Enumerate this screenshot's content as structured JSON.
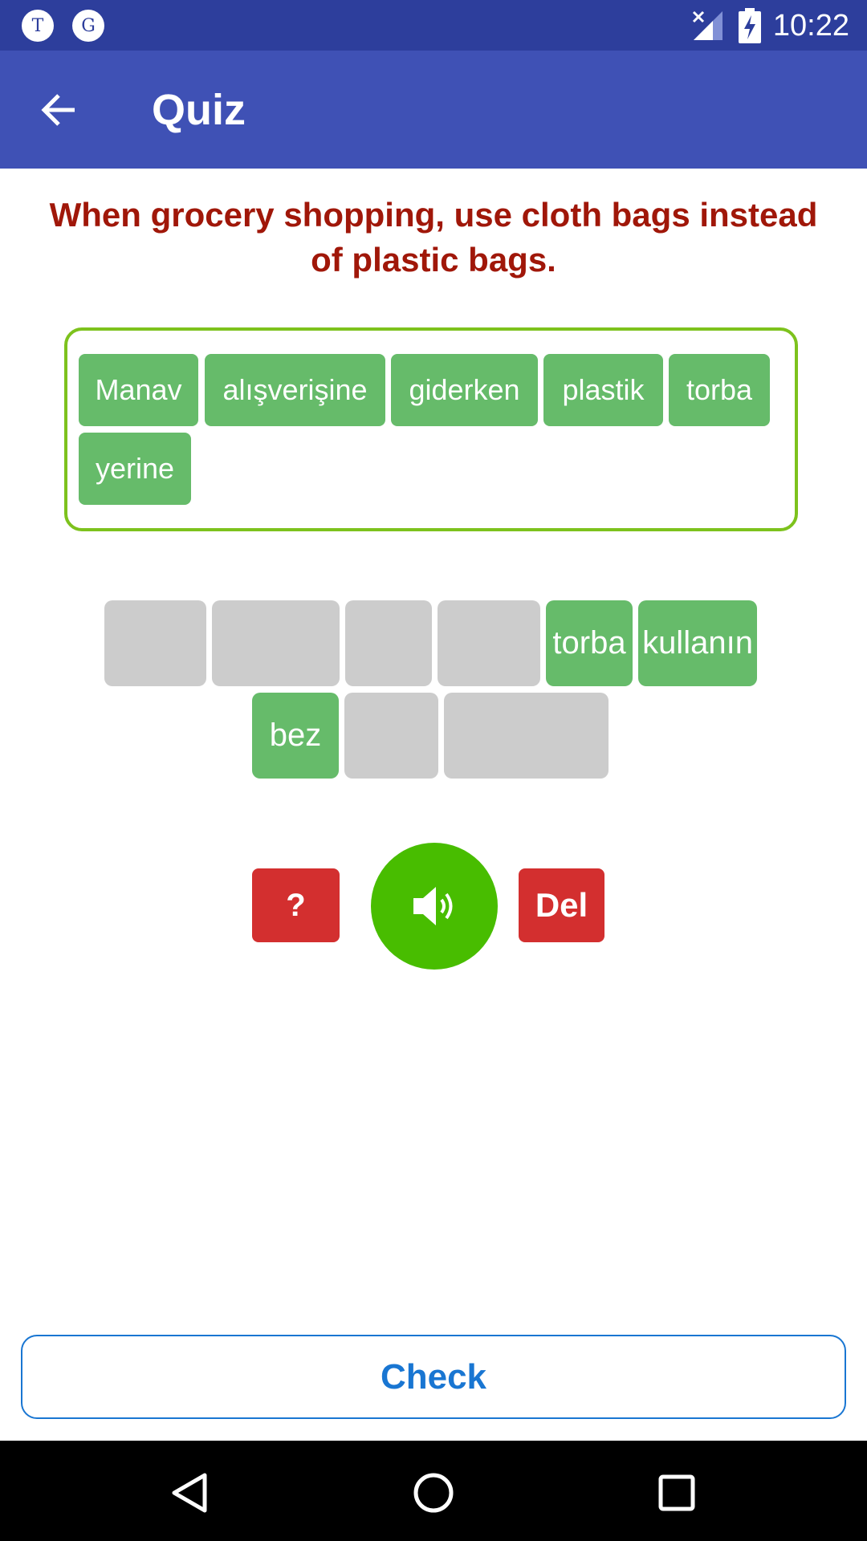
{
  "status_bar": {
    "time": "10:22",
    "app_icons": [
      "T",
      "G"
    ]
  },
  "app_bar": {
    "title": "Quiz"
  },
  "prompt": {
    "text": "When grocery shopping, use cloth bags instead of plastic bags."
  },
  "answer_words": [
    "Manav",
    "alışverişine",
    "giderken",
    "plastik",
    "torba",
    "yerine"
  ],
  "slots": {
    "row1": [
      "",
      "",
      "",
      "",
      "torba",
      "kullanın"
    ],
    "row2": [
      "bez",
      "",
      ""
    ]
  },
  "controls": {
    "hint_label": "?",
    "del_label": "Del"
  },
  "footer": {
    "check_label": "Check"
  },
  "colors": {
    "status_bar": "#2d3e9c",
    "app_bar": "#3f51b5",
    "prompt_text": "#a01709",
    "chip": "#66bb6a",
    "slot_empty": "#cccccc",
    "answer_border": "#7dc21d",
    "red_button": "#d32f2f",
    "speaker": "#48bd00",
    "check": "#1976d2"
  }
}
